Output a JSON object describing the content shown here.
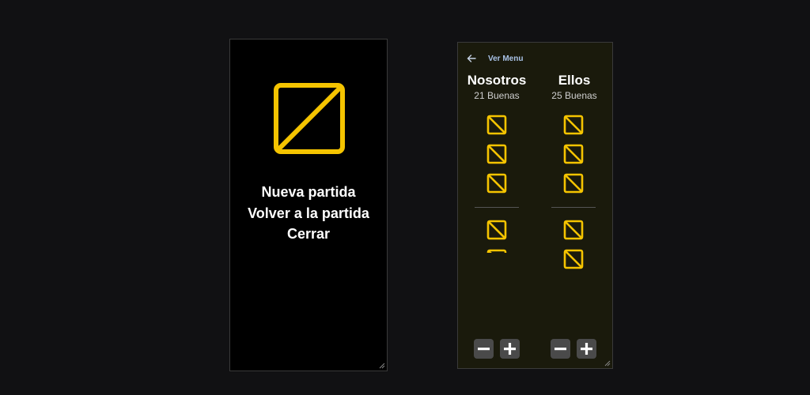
{
  "menu_window": {
    "logo_icon": "square-slash-icon",
    "items": [
      "Nueva partida",
      "Volver a la partida",
      "Cerrar"
    ]
  },
  "score_window": {
    "back_icon": "arrow-left-icon",
    "title": "Ver Menu",
    "teams": [
      {
        "name": "Nosotros",
        "subtitle": "21 Buenas",
        "malas_tallies": 3,
        "buenas_tallies": 2
      },
      {
        "name": "Ellos",
        "subtitle": "25 Buenas",
        "malas_tallies": 3,
        "buenas_tallies": 2
      }
    ],
    "minus_icon": "minus-icon",
    "plus_icon": "plus-icon"
  },
  "colors": {
    "accent": "#f5c400",
    "menu_bg": "#000000",
    "score_bg": "#1a1a0c",
    "desktop_bg": "#111113",
    "button_bg": "#4a4a4a",
    "title_blue": "#a9c2e6"
  }
}
